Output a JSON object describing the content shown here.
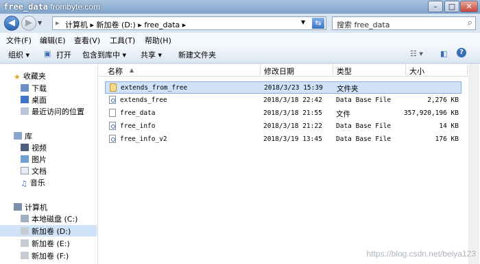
{
  "window": {
    "title_folder": "free_data",
    "title_site": "frombyte.com",
    "controls": [
      "minimize",
      "maximize",
      "close"
    ]
  },
  "address_bar": {
    "segments": [
      "计算机",
      "新加卷 (D:)",
      "free_data"
    ],
    "search_placeholder": "搜索 free_data"
  },
  "menu": [
    "文件(F)",
    "编辑(E)",
    "查看(V)",
    "工具(T)",
    "帮助(H)"
  ],
  "toolbar": {
    "organize": "组织 ▾",
    "open": "打开",
    "include_library": "包含到库中 ▾",
    "share": "共享 ▾",
    "new_folder": "新建文件夹"
  },
  "nav": {
    "favorites": "收藏夹",
    "fav_items": [
      "下载",
      "桌面",
      "最近访问的位置"
    ],
    "libraries": "库",
    "lib_items": [
      "视频",
      "图片",
      "文档",
      "音乐"
    ],
    "computer": "计算机",
    "drives": [
      "本地磁盘 (C:)",
      "新加卷 (D:)",
      "新加卷 (E:)",
      "新加卷 (F:)"
    ]
  },
  "columns": {
    "name": "名称",
    "modified": "修改日期",
    "type": "类型",
    "size": "大小"
  },
  "files": [
    {
      "name": "extends_from_free",
      "modified": "2018/3/23 15:39",
      "type": "文件夹",
      "size": "",
      "icon": "folder-icon"
    },
    {
      "name": "extends_free",
      "modified": "2018/3/18 22:42",
      "type": "Data Base File",
      "size": "2,276 KB",
      "icon": "database-file-icon"
    },
    {
      "name": "free_data",
      "modified": "2018/3/18 21:55",
      "type": "文件",
      "size": "357,920,196 KB",
      "icon": "file-icon"
    },
    {
      "name": "free_info",
      "modified": "2018/3/18 21:22",
      "type": "Data Base File",
      "size": "14 KB",
      "icon": "database-file-icon"
    },
    {
      "name": "free_info_v2",
      "modified": "2018/3/19 13:45",
      "type": "Data Base File",
      "size": "176 KB",
      "icon": "database-file-icon"
    }
  ],
  "watermark": "https://blog.csdn.net/beiya123"
}
